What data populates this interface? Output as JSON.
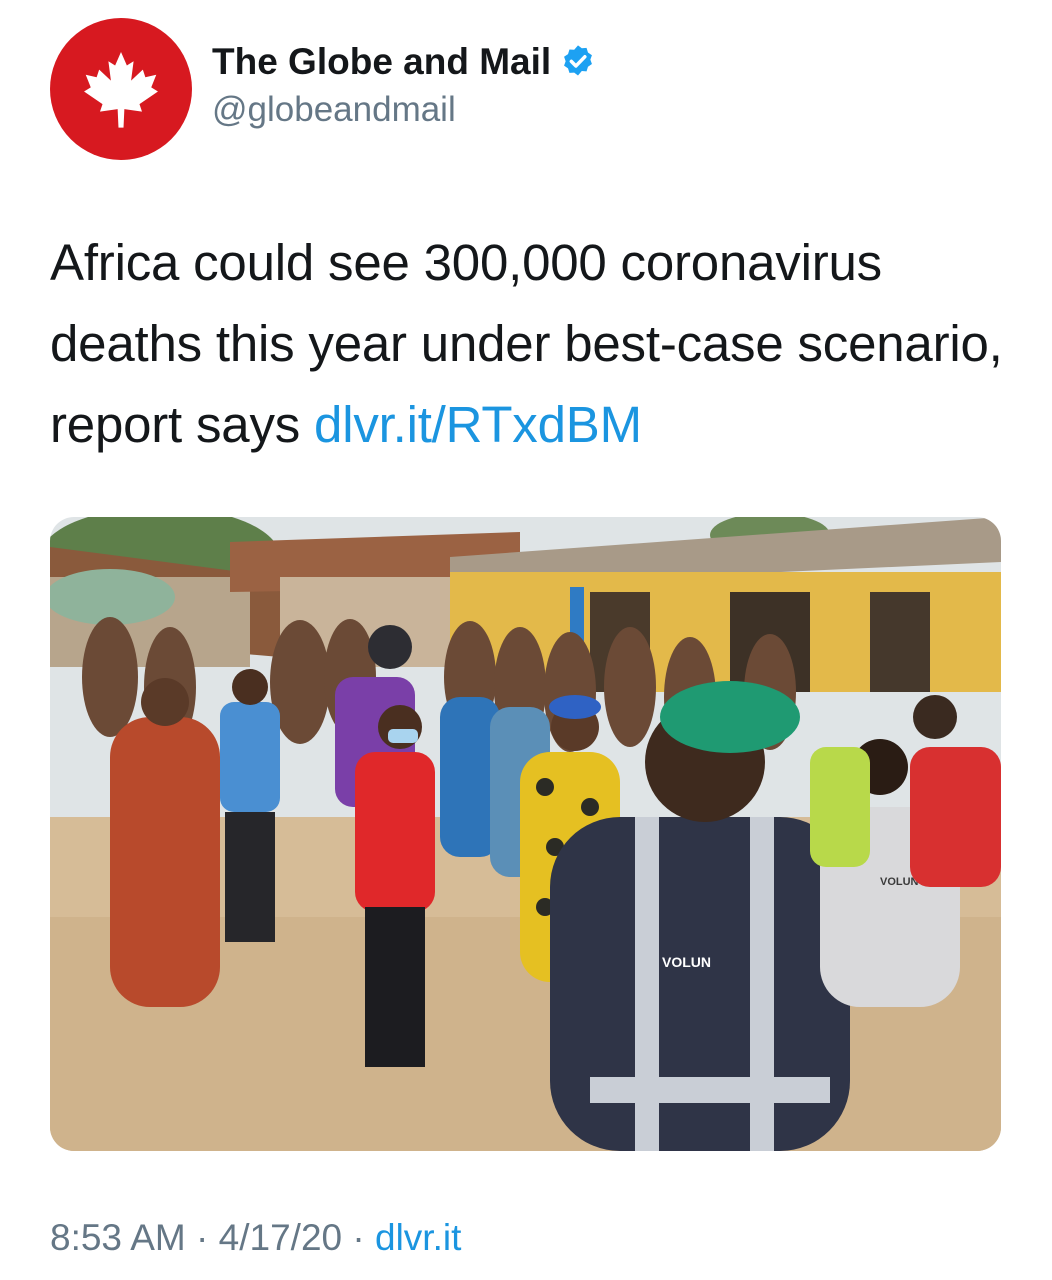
{
  "account": {
    "display_name": "The Globe and Mail",
    "handle": "@globeandmail",
    "verified": true,
    "avatar_icon": "maple-leaf-icon",
    "avatar_color": "#d71920"
  },
  "tweet": {
    "text": "Africa could see 300,000 coronavirus deaths this year under best-case scenario, report says ",
    "link_text": "dlvr.it/RTxdBM",
    "link_color": "#1b95e0"
  },
  "media": {
    "type": "photo",
    "vest_text_left": "VOLUNTEER",
    "vest_text_right": "VOLUN"
  },
  "meta": {
    "time": "8:53 AM",
    "separator": "·",
    "date": "4/17/20",
    "source": "dlvr.it"
  }
}
